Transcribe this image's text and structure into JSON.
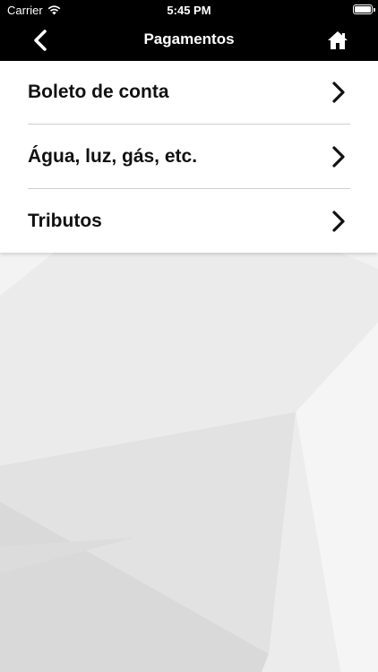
{
  "status_bar": {
    "carrier": "Carrier",
    "time": "5:45 PM",
    "wifi_icon": "wifi-icon",
    "battery_icon": "battery-icon"
  },
  "nav": {
    "title": "Pagamentos",
    "back_icon": "chevron-left-icon",
    "home_icon": "home-icon"
  },
  "menu": {
    "items": [
      {
        "label": "Boleto de conta",
        "icon": "chevron-right-icon"
      },
      {
        "label": "Água, luz, gás, etc.",
        "icon": "chevron-right-icon"
      },
      {
        "label": "Tributos",
        "icon": "chevron-right-icon"
      }
    ]
  },
  "colors": {
    "bar": "#000000",
    "menu_bg": "#ffffff",
    "text": "#111111",
    "background": "#e6e6e6"
  }
}
